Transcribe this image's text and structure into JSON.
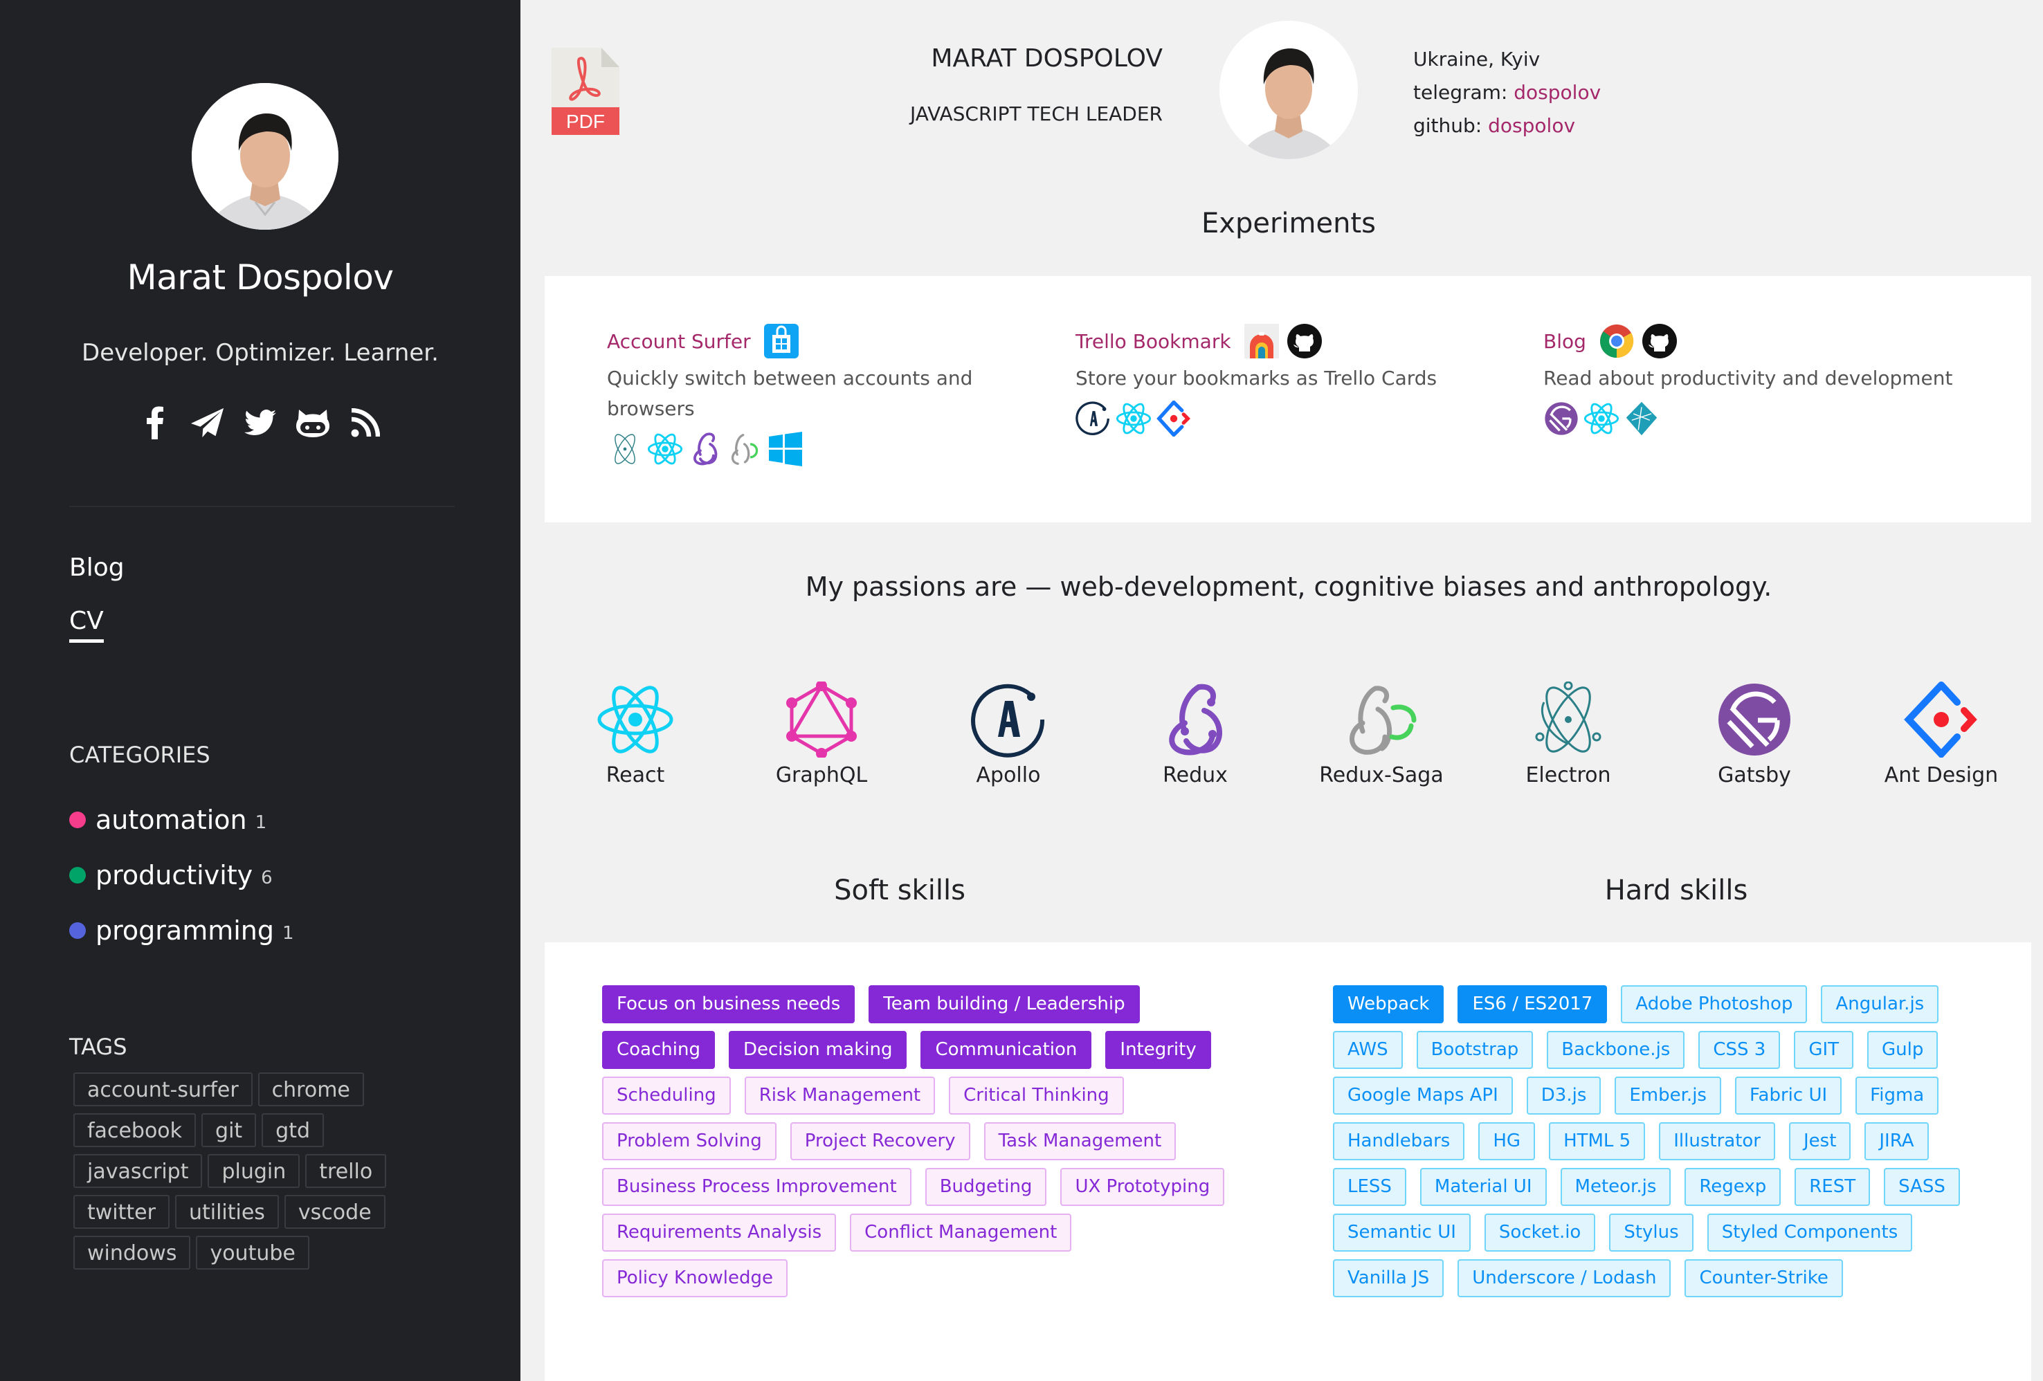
{
  "sidebar": {
    "name": "Marat Dospolov",
    "tagline": "Developer. Optimizer. Learner.",
    "social": [
      {
        "icon": "facebook-icon"
      },
      {
        "icon": "telegram-icon"
      },
      {
        "icon": "twitter-icon"
      },
      {
        "icon": "github-icon"
      },
      {
        "icon": "rss-icon"
      }
    ],
    "nav": [
      {
        "label": "Blog",
        "active": false
      },
      {
        "label": "CV",
        "active": true
      }
    ],
    "categories_title": "CATEGORIES",
    "categories": [
      {
        "label": "automation",
        "count": "1",
        "color": "#f53d8c"
      },
      {
        "label": "productivity",
        "count": "6",
        "color": "#00a368"
      },
      {
        "label": "programming",
        "count": "1",
        "color": "#5563dd"
      }
    ],
    "tags_title": "TAGS",
    "tags": [
      "account-surfer",
      "chrome",
      "facebook",
      "git",
      "gtd",
      "javascript",
      "plugin",
      "trello",
      "twitter",
      "utilities",
      "vscode",
      "windows",
      "youtube"
    ]
  },
  "header": {
    "pdf_label": "PDF",
    "name": "MARAT DOSPOLOV",
    "role": "JAVASCRIPT TECH LEADER",
    "location": "Ukraine, Kyiv",
    "telegram_label": "telegram:",
    "telegram_value": "dospolov",
    "github_label": "github:",
    "github_value": "dospolov"
  },
  "experiments": {
    "title": "Experiments",
    "items": [
      {
        "name": "Account Surfer",
        "desc": "Quickly switch between accounts and browsers",
        "links": [
          "windows-store-icon"
        ],
        "stack": [
          "electron-icon",
          "react-icon",
          "redux-icon",
          "redux-saga-icon",
          "windows-icon"
        ]
      },
      {
        "name": "Trello Bookmark",
        "desc": "Store your bookmarks as Trello Cards",
        "links": [
          "chrome-webstore-icon",
          "github-icon"
        ],
        "stack": [
          "apollo-icon",
          "react-icon",
          "ant-design-icon"
        ]
      },
      {
        "name": "Blog",
        "desc": "Read about productivity and development",
        "links": [
          "chrome-icon",
          "github-icon"
        ],
        "stack": [
          "gatsby-icon",
          "react-icon",
          "netlify-icon"
        ]
      }
    ]
  },
  "passions": "My passions are — web-development, cognitive biases and anthropology.",
  "technologies": [
    {
      "label": "React",
      "icon": "react-icon"
    },
    {
      "label": "GraphQL",
      "icon": "graphql-icon"
    },
    {
      "label": "Apollo",
      "icon": "apollo-icon"
    },
    {
      "label": "Redux",
      "icon": "redux-icon"
    },
    {
      "label": "Redux-Saga",
      "icon": "redux-saga-icon"
    },
    {
      "label": "Electron",
      "icon": "electron-icon"
    },
    {
      "label": "Gatsby",
      "icon": "gatsby-icon"
    },
    {
      "label": "Ant Design",
      "icon": "ant-design-icon"
    }
  ],
  "soft_skills": {
    "title": "Soft skills",
    "primary": [
      "Focus on business needs",
      "Team building / Leadership",
      "Coaching",
      "Decision making",
      "Communication",
      "Integrity"
    ],
    "secondary": [
      "Scheduling",
      "Risk Management",
      "Critical Thinking",
      "Problem Solving",
      "Project Recovery",
      "Task Management",
      "Business Process Improvement",
      "Budgeting",
      "UX Prototyping",
      "Requirements Analysis",
      "Conflict Management",
      "Policy Knowledge"
    ]
  },
  "hard_skills": {
    "title": "Hard skills",
    "primary": [
      "Webpack",
      "ES6 / ES2017"
    ],
    "secondary": [
      "Adobe Photoshop",
      "Angular.js",
      "AWS",
      "Bootstrap",
      "Backbone.js",
      "CSS 3",
      "GIT",
      "Gulp",
      "Google Maps API",
      "D3.js",
      "Ember.js",
      "Fabric UI",
      "Figma",
      "Handlebars",
      "HG",
      "HTML 5",
      "Illustrator",
      "Jest",
      "JIRA",
      "LESS",
      "Material UI",
      "Meteor.js",
      "Regexp",
      "REST",
      "SASS",
      "Semantic UI",
      "Socket.io",
      "Stylus",
      "Styled Components",
      "Vanilla JS",
      "Underscore / Lodash",
      "Counter-Strike"
    ]
  },
  "colors": {
    "sidebar_bg": "#212226",
    "page_bg": "#f1f1f1",
    "link": "#a4286a",
    "soft_primary": "#8529d6",
    "hard_primary": "#0a8ff6"
  }
}
